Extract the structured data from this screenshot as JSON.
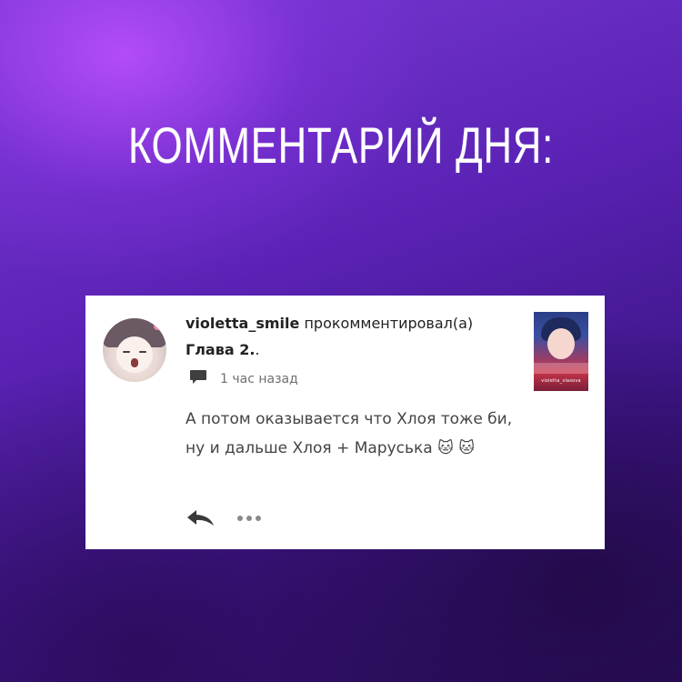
{
  "headline": "КОММЕНТАРИЙ ДНЯ:",
  "comment": {
    "username": "violetta_smile",
    "action": "прокомментировал(а)",
    "chapter": "Глава 2.",
    "chapter_suffix": ".",
    "time": "1 час назад",
    "text": "А потом оказывается что Хлоя тоже би, ну и дальше  Хлоя + Маруська 🐱 🐱",
    "cover_caption": "violetta_vlasova"
  },
  "icons": {
    "comment": "speech-bubble-icon",
    "reply": "reply-arrow-icon",
    "more": "more-dots-icon"
  },
  "colors": {
    "background_accent": "#7a3bd6",
    "card": "#ffffff",
    "meta_text": "#6f6f6f"
  }
}
